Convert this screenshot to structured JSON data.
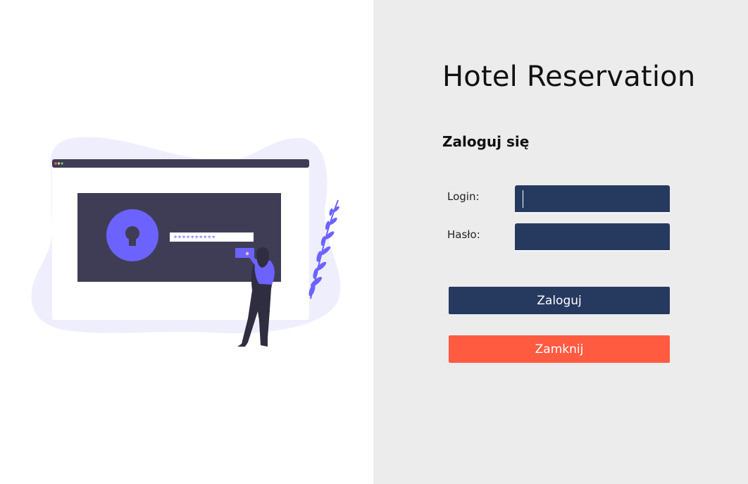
{
  "app": {
    "title": "Hotel Reservation"
  },
  "form": {
    "heading": "Zaloguj się",
    "login_label": "Login:",
    "login_value": "",
    "password_label": "Hasło:",
    "password_value": "",
    "submit_label": "Zaloguj",
    "close_label": "Zamknij"
  },
  "illustration": {
    "masked_password": "**********",
    "icons": [
      "padlock-keyhole-icon",
      "browser-window",
      "person-figure",
      "plant-leaves"
    ]
  },
  "colors": {
    "navy": "#263a5f",
    "coral": "#ff5b41",
    "accent_purple": "#6c63ff",
    "panel_gray": "#ececed",
    "dark_screen": "#3f3d56",
    "blob": "#efeefc"
  }
}
